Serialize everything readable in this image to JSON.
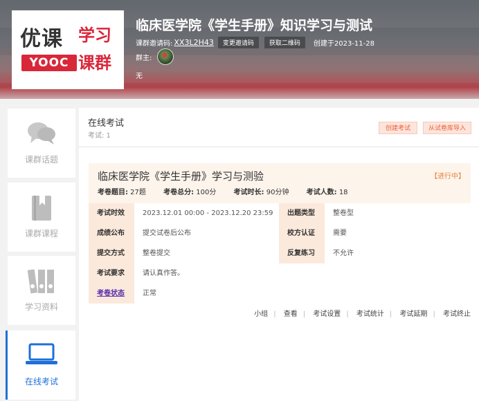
{
  "header": {
    "logo": {
      "line1": "优课",
      "line2": "学习",
      "badge": "YOOC",
      "line3": "课群"
    },
    "course_title": "临床医学院《学生手册》知识学习与测试",
    "invite_label": "课群邀请码:",
    "invite_code": "XX3L2H43",
    "change_code_label": "变更邀请码",
    "get_qr_label": "获取二维码",
    "created_label": "创建于2023-11-28",
    "owner_label": "群主:",
    "description": "无"
  },
  "sidebar": {
    "items": [
      {
        "label": "课群话题",
        "icon": "chat-bubbles-icon"
      },
      {
        "label": "课群课程",
        "icon": "book-icon"
      },
      {
        "label": "学习资料",
        "icon": "binders-icon"
      },
      {
        "label": "在线考试",
        "icon": "laptop-icon",
        "active": true
      }
    ]
  },
  "main": {
    "title": "在线考试",
    "subtitle": "考试: 1",
    "create_button": "创建考试",
    "import_button": "从试卷库导入",
    "exam": {
      "title": "临床医学院《学生手册》学习与测验",
      "status": "【进行中】",
      "stats": [
        {
          "k": "考卷题目:",
          "v": " 27题"
        },
        {
          "k": "考卷总分:",
          "v": " 100分"
        },
        {
          "k": "考试时长:",
          "v": " 90分钟"
        },
        {
          "k": "考试人数:",
          "v": " 18"
        }
      ],
      "details": {
        "period_k": "考试时效",
        "period_v": "2023.12.01 00:00 - 2023.12.20 23:59",
        "type_k": "出题类型",
        "type_v": "整卷型",
        "score_k": "成绩公布",
        "score_v": "提交试卷后公布",
        "auth_k": "校方认证",
        "auth_v": "需要",
        "submit_k": "提交方式",
        "submit_v": "整卷提交",
        "practice_k": "反复练习",
        "practice_v": "不允许",
        "req_k": "考试要求",
        "req_v": "请认真作答。",
        "state_k": "考卷状态",
        "state_v": "正常"
      },
      "actions": [
        "小组",
        "查看",
        "考试设置",
        "考试统计",
        "考试延期",
        "考试终止"
      ]
    }
  },
  "colors": {
    "accent": "#1e6fd9",
    "brand_red": "#d9273a",
    "orange": "#e8623a"
  }
}
